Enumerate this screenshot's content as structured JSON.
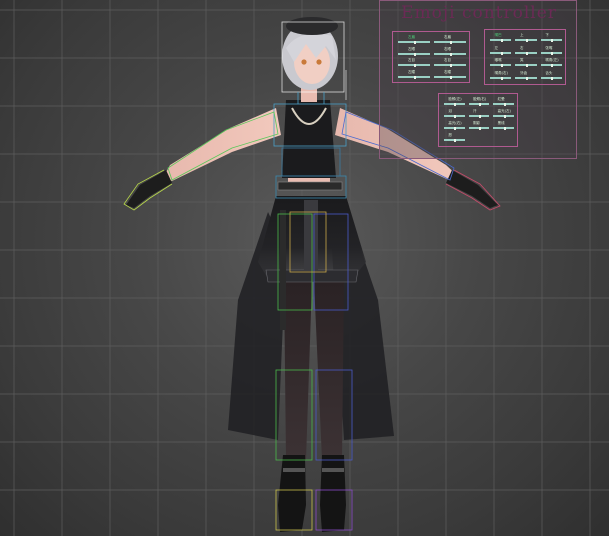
{
  "viewport": {
    "background_top": "#4f4f4f",
    "background_bottom": "#303030",
    "grid_color": "#5e5e5e"
  },
  "emoji_controller": {
    "title": "Emoji controller",
    "title_color": "#6b2a55",
    "border_color": "#b05a90",
    "groups": [
      {
        "name": "left-group",
        "items": [
          {
            "label": "左眉",
            "green": true
          },
          {
            "label": "右眉",
            "green": false
          },
          {
            "label": "左眼",
            "green": false
          },
          {
            "label": "右眼",
            "green": false
          },
          {
            "label": "左目",
            "green": false
          },
          {
            "label": "右目",
            "green": false
          },
          {
            "label": "左瞳",
            "green": false
          },
          {
            "label": "右瞳",
            "green": false
          }
        ]
      },
      {
        "name": "right-group",
        "items": [
          {
            "label": "嘴巴",
            "green": true
          },
          {
            "label": "上",
            "green": false
          },
          {
            "label": "下",
            "green": false
          },
          {
            "label": "左",
            "green": false
          },
          {
            "label": "右",
            "green": false
          },
          {
            "label": "张嘴",
            "green": false
          },
          {
            "label": "嘟嘴",
            "green": false
          },
          {
            "label": "笑",
            "green": false
          },
          {
            "label": "嘴角(左)",
            "green": false
          },
          {
            "label": "嘴角(右)",
            "green": false
          },
          {
            "label": "牙齿",
            "green": false
          },
          {
            "label": "舌头",
            "green": false
          }
        ]
      },
      {
        "name": "bottom-group",
        "items": [
          {
            "label": "脸颊(左)",
            "green": false
          },
          {
            "label": "脸颊(右)",
            "green": false
          },
          {
            "label": "红晕",
            "green": false
          },
          {
            "label": "泪",
            "green": false
          },
          {
            "label": "汗",
            "green": false
          },
          {
            "label": "高光(左)",
            "green": false
          },
          {
            "label": "高光(右)",
            "green": false
          },
          {
            "label": "阴影",
            "green": false
          },
          {
            "label": "黑线",
            "green": false
          },
          {
            "label": "怒",
            "green": false
          }
        ]
      }
    ]
  }
}
